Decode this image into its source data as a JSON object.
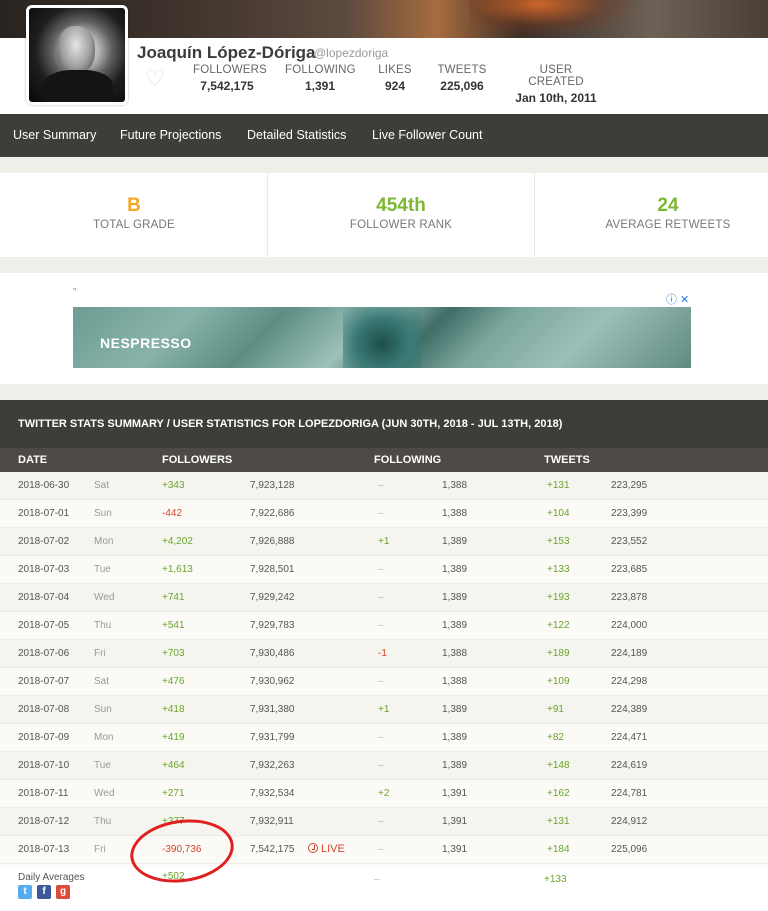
{
  "profile": {
    "name": "Joaquín López-Dóriga",
    "handle": "@lopezdoriga",
    "stats": [
      {
        "label": "FOLLOWERS",
        "value": "7,542,175"
      },
      {
        "label": "FOLLOWING",
        "value": "1,391"
      },
      {
        "label": "LIKES",
        "value": "924"
      },
      {
        "label": "TWEETS",
        "value": "225,096"
      },
      {
        "label": "USER CREATED",
        "value": "Jan 10th, 2011"
      }
    ]
  },
  "nav": [
    "User Summary",
    "Future Projections",
    "Detailed Statistics",
    "Live Follower Count"
  ],
  "grades": [
    {
      "value": "B",
      "label": "TOTAL GRADE",
      "color": "#f5a623"
    },
    {
      "value": "454th",
      "label": "FOLLOWER RANK",
      "color": "#7db833"
    },
    {
      "value": "24",
      "label": "AVERAGE RETWEETS",
      "color": "#7db833"
    }
  ],
  "ad": {
    "quote": "\"",
    "brand": "NESPRESSO",
    "icons": "ⓘ ✕"
  },
  "table": {
    "title": "TWITTER STATS SUMMARY / USER STATISTICS FOR LOPEZDORIGA (JUN 30TH, 2018 - JUL 13TH, 2018)",
    "headers": [
      "DATE",
      "FOLLOWERS",
      "FOLLOWING",
      "TWEETS"
    ],
    "rows": [
      {
        "date": "2018-06-30",
        "day": "Sat",
        "fchg": "+343",
        "ftot": "7,923,128",
        "gchg": "–",
        "gtot": "1,388",
        "tchg": "+131",
        "ttot": "223,295"
      },
      {
        "date": "2018-07-01",
        "day": "Sun",
        "fchg": "-442",
        "ftot": "7,922,686",
        "gchg": "–",
        "gtot": "1,388",
        "tchg": "+104",
        "ttot": "223,399"
      },
      {
        "date": "2018-07-02",
        "day": "Mon",
        "fchg": "+4,202",
        "ftot": "7,926,888",
        "gchg": "+1",
        "gtot": "1,389",
        "tchg": "+153",
        "ttot": "223,552"
      },
      {
        "date": "2018-07-03",
        "day": "Tue",
        "fchg": "+1,613",
        "ftot": "7,928,501",
        "gchg": "–",
        "gtot": "1,389",
        "tchg": "+133",
        "ttot": "223,685"
      },
      {
        "date": "2018-07-04",
        "day": "Wed",
        "fchg": "+741",
        "ftot": "7,929,242",
        "gchg": "–",
        "gtot": "1,389",
        "tchg": "+193",
        "ttot": "223,878"
      },
      {
        "date": "2018-07-05",
        "day": "Thu",
        "fchg": "+541",
        "ftot": "7,929,783",
        "gchg": "–",
        "gtot": "1,389",
        "tchg": "+122",
        "ttot": "224,000"
      },
      {
        "date": "2018-07-06",
        "day": "Fri",
        "fchg": "+703",
        "ftot": "7,930,486",
        "gchg": "-1",
        "gtot": "1,388",
        "tchg": "+189",
        "ttot": "224,189"
      },
      {
        "date": "2018-07-07",
        "day": "Sat",
        "fchg": "+476",
        "ftot": "7,930,962",
        "gchg": "–",
        "gtot": "1,388",
        "tchg": "+109",
        "ttot": "224,298"
      },
      {
        "date": "2018-07-08",
        "day": "Sun",
        "fchg": "+418",
        "ftot": "7,931,380",
        "gchg": "+1",
        "gtot": "1,389",
        "tchg": "+91",
        "ttot": "224,389"
      },
      {
        "date": "2018-07-09",
        "day": "Mon",
        "fchg": "+419",
        "ftot": "7,931,799",
        "gchg": "–",
        "gtot": "1,389",
        "tchg": "+82",
        "ttot": "224,471"
      },
      {
        "date": "2018-07-10",
        "day": "Tue",
        "fchg": "+464",
        "ftot": "7,932,263",
        "gchg": "–",
        "gtot": "1,389",
        "tchg": "+148",
        "ttot": "224,619"
      },
      {
        "date": "2018-07-11",
        "day": "Wed",
        "fchg": "+271",
        "ftot": "7,932,534",
        "gchg": "+2",
        "gtot": "1,391",
        "tchg": "+162",
        "ttot": "224,781"
      },
      {
        "date": "2018-07-12",
        "day": "Thu",
        "fchg": "+377",
        "ftot": "7,932,911",
        "gchg": "–",
        "gtot": "1,391",
        "tchg": "+131",
        "ttot": "224,912"
      },
      {
        "date": "2018-07-13",
        "day": "Fri",
        "fchg": "-390,736",
        "ftot": "7,542,175",
        "gchg": "–",
        "gtot": "1,391",
        "tchg": "+184",
        "ttot": "225,096",
        "live": "LIVE"
      }
    ],
    "averages": {
      "label": "Daily Averages",
      "followers": "+502",
      "following": "–",
      "tweets": "+133"
    }
  },
  "colors": {
    "positive": "#6aa52a",
    "negative": "#d2472f",
    "nav_bg": "#3f3d39"
  }
}
